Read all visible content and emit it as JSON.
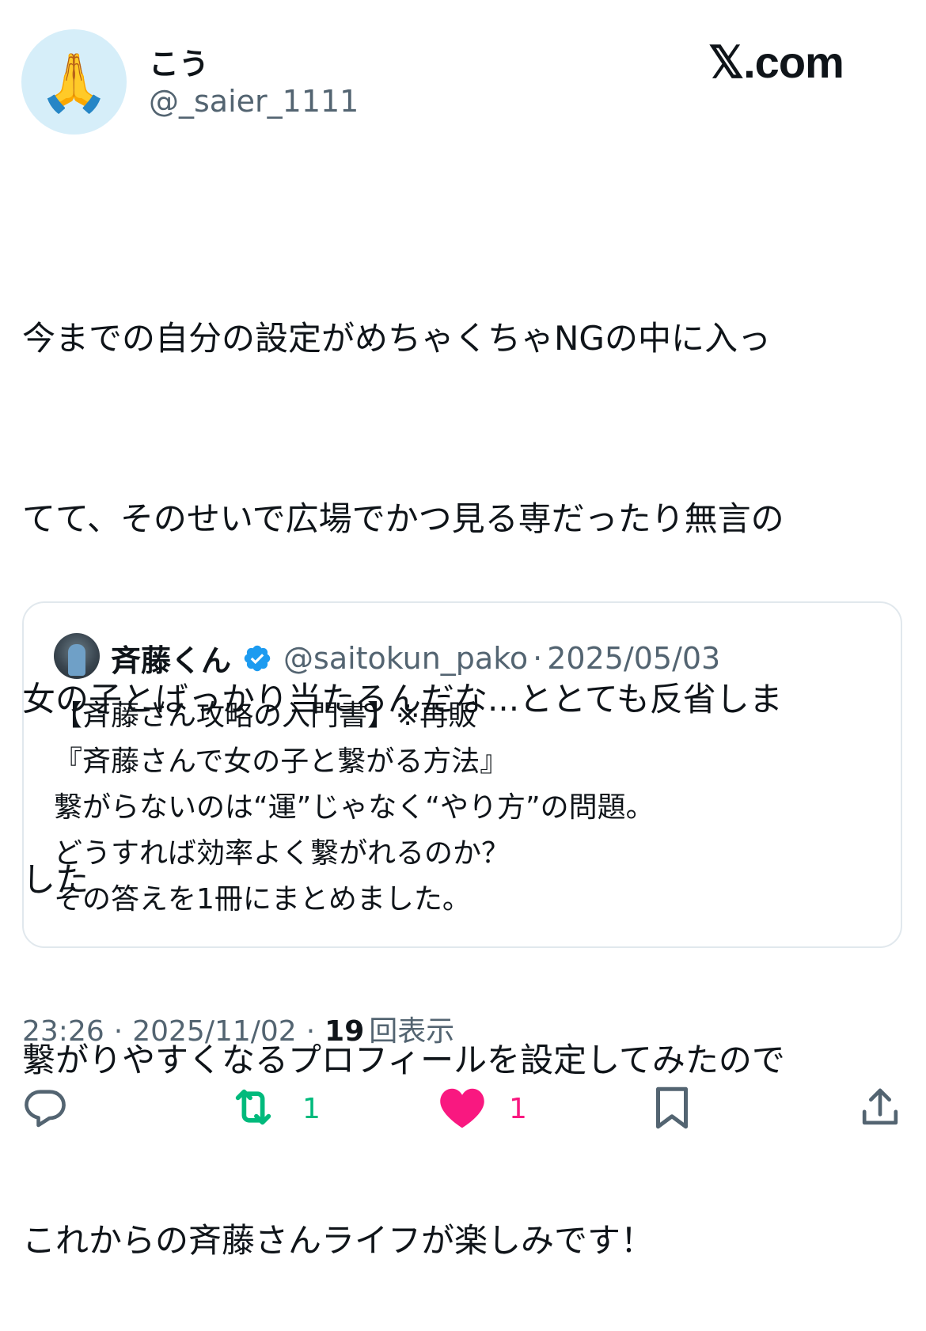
{
  "author": {
    "avatar_emoji": "🙏",
    "display_name": "こう",
    "handle": "@_saier_1111"
  },
  "brand": {
    "x_glyph": "𝕏",
    "suffix": ".com"
  },
  "tweet": {
    "lines": [
      "今までの自分の設定がめちゃくちゃNGの中に入っ",
      "てて、そのせいで広場でかつ見る専だったり無言の",
      "女の子とばっかり当たるんだな...ととても反省しま",
      "した",
      "繋がりやすくなるプロフィールを設定してみたので",
      "これからの斉藤さんライフが楽しみです！"
    ]
  },
  "quote": {
    "display_name": "斉藤くん",
    "handle": "@saitokun_pako",
    "separator": "·",
    "date": "2025/05/03",
    "lines": [
      "【斉藤さん攻略の入門書】※再販",
      "『斉藤さんで女の子と繋がる方法』",
      "繋がらないのは“運”じゃなく“やり方”の問題。",
      "どうすれば効率よく繋がれるのか？",
      "その答えを1冊にまとめました。"
    ]
  },
  "meta": {
    "time": "23:26",
    "date": "2025/11/02",
    "separator": "·",
    "views_count": "19",
    "views_label": "回表示"
  },
  "actions": {
    "reply_icon": "reply-icon",
    "retweet_icon": "retweet-icon",
    "retweet_count": "1",
    "like_icon": "heart-icon",
    "like_count": "1",
    "bookmark_icon": "bookmark-icon",
    "share_icon": "share-icon"
  },
  "colors": {
    "text": "#0f1419",
    "secondary": "#536471",
    "verified": "#1d9bf0",
    "retweet": "#00ba7c",
    "like": "#f91880",
    "border": "#e1e8ed"
  }
}
